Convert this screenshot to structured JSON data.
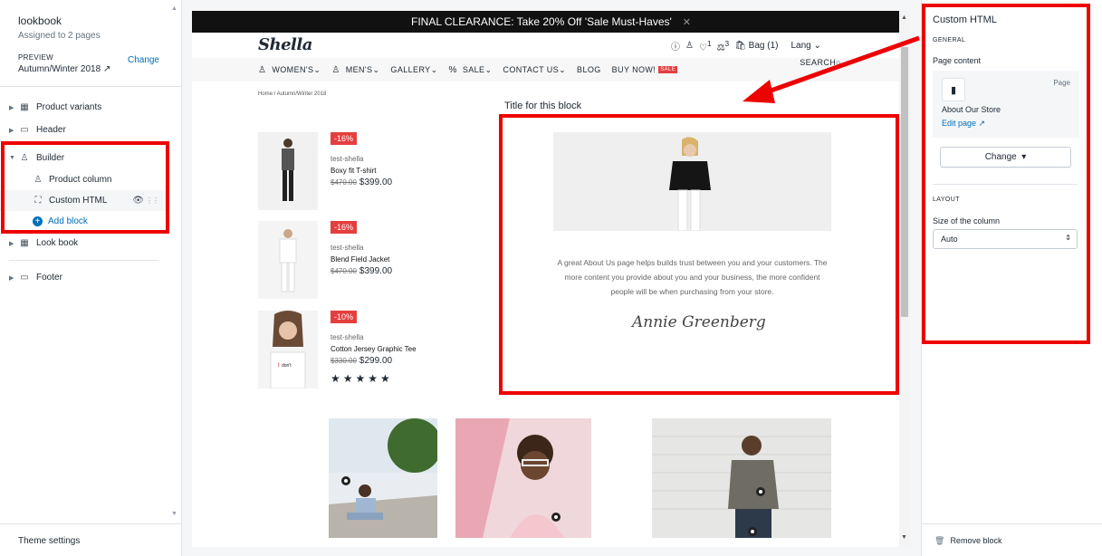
{
  "left": {
    "store_name": "lookbook",
    "assigned": "Assigned to 2 pages",
    "preview_label": "PREVIEW",
    "preview_value": "Autumn/Winter 2018",
    "change_label": "Change",
    "tree": {
      "product_variants": "Product variants",
      "header": "Header",
      "builder": "Builder",
      "product_column": "Product column",
      "custom_html": "Custom HTML",
      "add_block": "Add block",
      "look_book": "Look book",
      "footer": "Footer"
    },
    "theme_settings": "Theme settings"
  },
  "preview": {
    "announcement": "FINAL CLEARANCE: Take 20% Off 'Sale Must-Haves'",
    "logo": "Shella",
    "header_icons": {
      "wishlist_count": "1",
      "compare_count": "3",
      "bag": "Bag (1)",
      "lang": "Lang"
    },
    "nav": [
      "WOMEN'S",
      "MEN'S",
      "GALLERY",
      "SALE",
      "CONTACT US",
      "BLOG",
      "BUY NOW!"
    ],
    "nav_badge": "SALE",
    "search": "SEARCH",
    "breadcrumb": "Home  /  Autumn/Winter 2018",
    "products": [
      {
        "badge": "-16%",
        "vendor": "test-shella",
        "name": "Boxy fit T-shirt",
        "old_price": "$470.00",
        "price": "$399.00"
      },
      {
        "badge": "-16%",
        "vendor": "test-shella",
        "name": "Blend Field Jacket",
        "old_price": "$470.00",
        "price": "$399.00"
      },
      {
        "badge": "-10%",
        "vendor": "test-shella",
        "name": "Cotton Jersey Graphic Tee",
        "old_price": "$330.00",
        "price": "$299.00",
        "stars": "★★★★★"
      }
    ],
    "block_title": "Title for this block",
    "about_text": "A great About Us page helps builds trust between you and your customers. The more content you provide about you and your business, the more confident people will be when purchasing from your store.",
    "signature": "Annie Greenberg"
  },
  "right": {
    "title": "Custom HTML",
    "general": "GENERAL",
    "page_content": "Page content",
    "page_type": "Page",
    "page_name": "About Our Store",
    "edit_page": "Edit page",
    "change_button": "Change",
    "layout": "LAYOUT",
    "size_label": "Size of the column",
    "size_value": "Auto",
    "remove_block": "Remove block"
  },
  "colors": {
    "highlight": "#e00000",
    "link": "#006fbb",
    "sale": "#e53e3e"
  }
}
